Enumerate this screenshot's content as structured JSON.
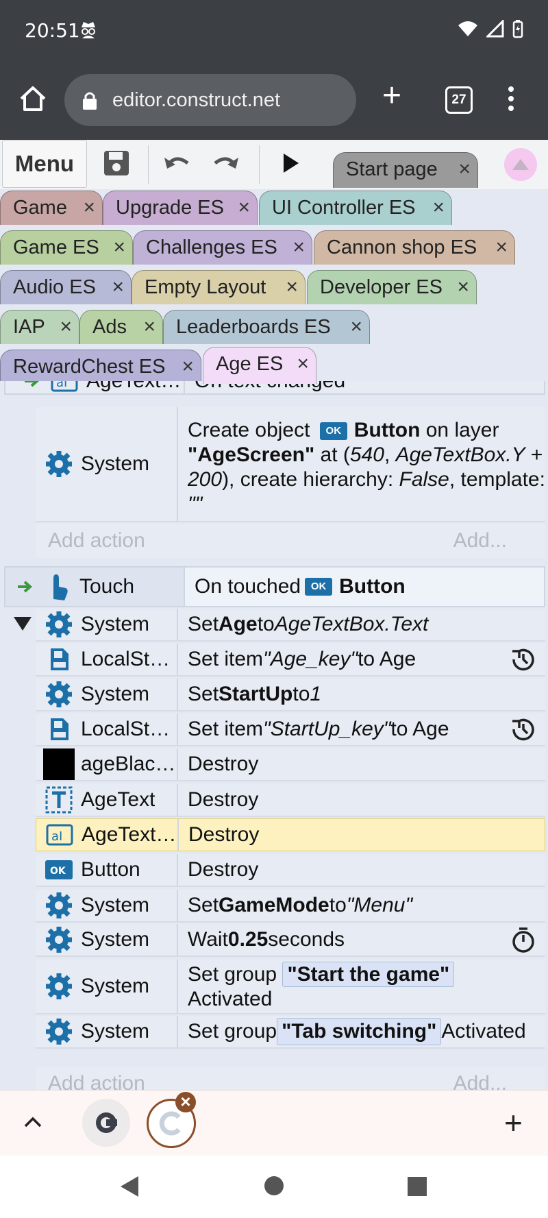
{
  "status": {
    "time": "20:51"
  },
  "browser": {
    "url": "editor.construct.net",
    "tab_count": "27"
  },
  "toolbar": {
    "menu_label": "Menu"
  },
  "tabs": {
    "start_page": "Start page",
    "game": "Game",
    "upgrade_es": "Upgrade ES",
    "ui_controller_es": "UI Controller ES",
    "game_es": "Game ES",
    "challenges_es": "Challenges ES",
    "cannon_shop_es": "Cannon shop ES",
    "audio_es": "Audio ES",
    "empty_layout": "Empty Layout",
    "developer_es": "Developer ES",
    "iap": "IAP",
    "ads": "Ads",
    "leaderboards_es": "Leaderboards ES",
    "rewardchest_es": "RewardChest ES",
    "age_es": "Age ES",
    "close_glyph": "×"
  },
  "sheet": {
    "prev_event": {
      "object": "AgeText…",
      "condition": "On text changed"
    },
    "create_action": {
      "object": "System",
      "t1": "Create object ",
      "badge": "OK",
      "t2": "Button",
      "t3": " on layer ",
      "t4": "\"AgeScreen\"",
      "t5": " at (",
      "t6": "540",
      "t7": ", ",
      "t8": "AgeTextBox.Y + 200",
      "t9": "), create hierarchy: ",
      "t10": "False",
      "t11": ", template: ",
      "t12": "\"\""
    },
    "add_action": "Add action",
    "add_more": "Add...",
    "touch_event": {
      "object": "Touch",
      "cond1": "On touched ",
      "badge": "OK",
      "cond2": "Button"
    },
    "actions": [
      {
        "object": "System",
        "a": "Set ",
        "b": "Age",
        "c": " to ",
        "d": "AgeTextBox.Text"
      },
      {
        "object": "LocalSt…",
        "a": "Set item ",
        "d": "\"Age_key\"",
        "c": " to Age"
      },
      {
        "object": "System",
        "a": "Set ",
        "b": "StartUp",
        "c": " to ",
        "d": "1"
      },
      {
        "object": "LocalSt…",
        "a": "Set item ",
        "d": "\"StartUp_key\"",
        "c": " to Age"
      },
      {
        "object": "ageBlac…",
        "a": "Destroy"
      },
      {
        "object": "AgeText",
        "a": "Destroy"
      },
      {
        "object": "AgeText…",
        "a": "Destroy"
      },
      {
        "object": "Button",
        "a": "Destroy"
      },
      {
        "object": "System",
        "a": "Set ",
        "b": "GameMode",
        "c": " to ",
        "d": "\"Menu\""
      },
      {
        "object": "System",
        "a": "Wait ",
        "b": "0.25",
        "c": " seconds"
      },
      {
        "object": "System",
        "a": "Set group ",
        "chip": "\"Start the game\"",
        "c": "Activated"
      },
      {
        "object": "System",
        "a": "Set group ",
        "chip": "\"Tab switching\"",
        "c": " Activated"
      }
    ],
    "ok_badge": "OK"
  },
  "colors": {
    "highlight_row": "#fcf1bf",
    "tab_game": "#c9a6a6",
    "tab_upgrade": "#c6add1",
    "tab_ui": "#a9cfcf",
    "tab_game_es": "#b8cfa0",
    "tab_challenges": "#c0b2d6",
    "tab_cannon": "#d1b8a5",
    "tab_audio": "#b6bad6",
    "tab_empty": "#d9cfa8",
    "tab_developer": "#b2d2b0",
    "tab_iap": "#b9d4b8",
    "tab_ads": "#b8d2a5",
    "tab_leaderboards": "#b3c6d4",
    "tab_rewardchest": "#b5b2d8",
    "tab_age_active": "#f3dcf8",
    "tab_start": "#9a9a9a"
  }
}
